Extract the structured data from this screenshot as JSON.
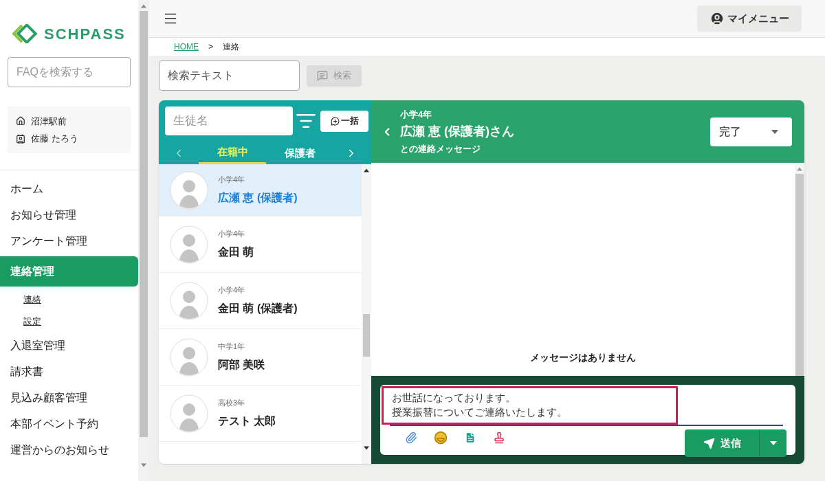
{
  "logo": {
    "text": "SCHPASS"
  },
  "sidebar": {
    "faq_search": {
      "placeholder": "FAQを検索する"
    },
    "school": "沼津駅前",
    "user": "佐藤 たろう",
    "nav": [
      {
        "label": "ホーム",
        "selected": false
      },
      {
        "label": "お知らせ管理",
        "selected": false
      },
      {
        "label": "アンケート管理",
        "selected": false
      },
      {
        "label": "連絡管理",
        "selected": true,
        "children": [
          {
            "label": "連絡"
          },
          {
            "label": "設定"
          }
        ]
      },
      {
        "label": "入退室管理",
        "selected": false
      },
      {
        "label": "請求書",
        "selected": false
      },
      {
        "label": "見込み顧客管理",
        "selected": false
      },
      {
        "label": "本部イベント予約",
        "selected": false
      },
      {
        "label": "運営からのお知らせ",
        "selected": false
      }
    ]
  },
  "header": {
    "my_menu": "マイメニュー"
  },
  "breadcrumb": {
    "items": [
      "HOME",
      "連絡"
    ],
    "separator": ">"
  },
  "search": {
    "placeholder": "検索テキスト",
    "button": "検索",
    "disabled": true
  },
  "contacts": {
    "name_filter": {
      "placeholder": "生徒名"
    },
    "bulk_button": "一括",
    "tabs": [
      {
        "label": "在籍中",
        "selected": true
      },
      {
        "label": "保護者",
        "selected": false
      }
    ],
    "items": [
      {
        "grade": "小学4年",
        "name": "広瀬 恵 (保護者)",
        "selected": true
      },
      {
        "grade": "小学4年",
        "name": "金田 萌",
        "selected": false
      },
      {
        "grade": "小学4年",
        "name": "金田 萌 (保護者)",
        "selected": false
      },
      {
        "grade": "中学1年",
        "name": "阿部 美咲",
        "selected": false
      },
      {
        "grade": "高校3年",
        "name": "テスト 太郎",
        "selected": false
      }
    ]
  },
  "chat": {
    "grade": "小学4年",
    "title": "広瀬 恵 (保護者)さん",
    "subtitle": "との連絡メッセージ",
    "status": "完了",
    "empty_message": "メッセージはありません",
    "draft": [
      "お世話になっております。",
      "授業振替についてご連絡いたします。"
    ],
    "send_button": "送信"
  }
}
